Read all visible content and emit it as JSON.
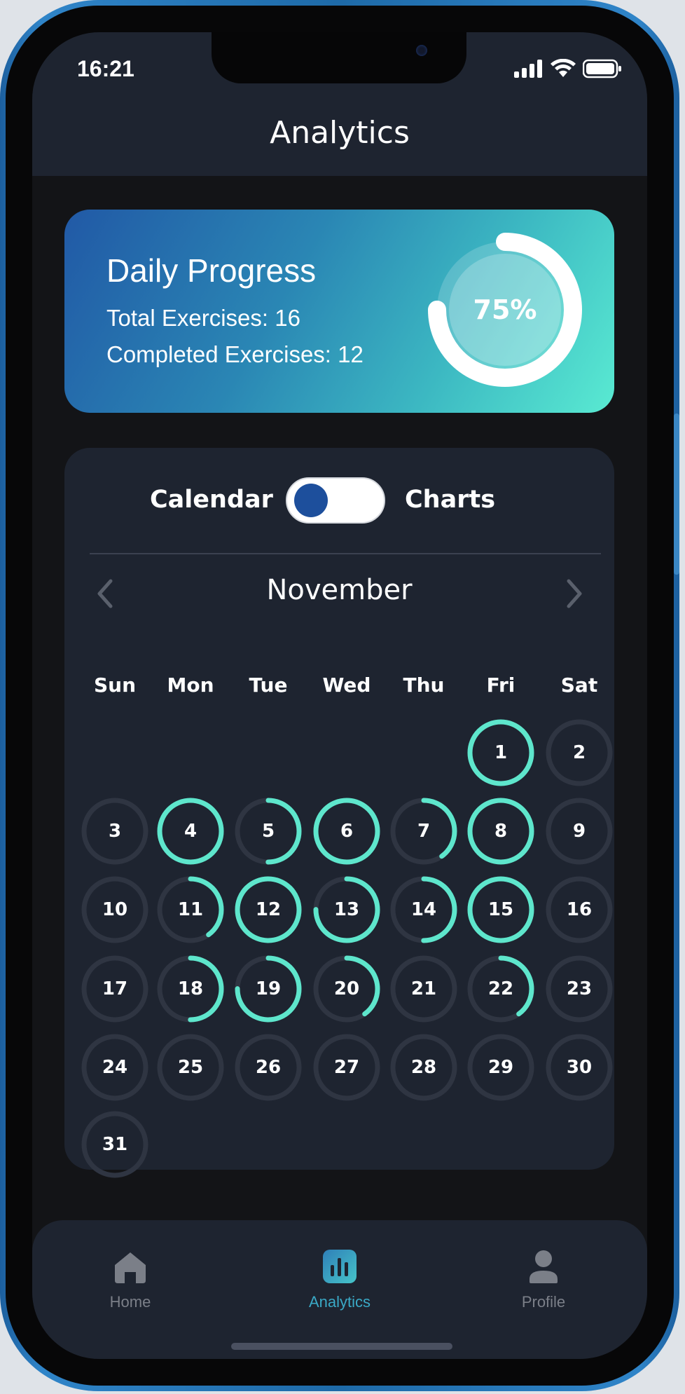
{
  "status_bar": {
    "time": "16:21"
  },
  "header": {
    "title": "Analytics"
  },
  "progress": {
    "title": "Daily Progress",
    "total_line": "Total Exercises: 16",
    "completed_line": "Completed Exercises: 12",
    "percent_label": "75%",
    "percent_value": 0.75,
    "ring_color": "#ffffff"
  },
  "view_toggle": {
    "left_label": "Calendar",
    "right_label": "Charts",
    "knob_color": "#1d4f9c"
  },
  "calendar": {
    "month": "November",
    "weekdays": [
      "Sun",
      "Mon",
      "Tue",
      "Wed",
      "Thu",
      "Fri",
      "Sat"
    ],
    "first_weekday_index": 5,
    "accent_color": "#5ee6cc",
    "track_color": "#2f3542",
    "days": [
      {
        "label": "1",
        "progress": 1.0
      },
      {
        "label": "2",
        "progress": 0
      },
      {
        "label": "3",
        "progress": 0
      },
      {
        "label": "4",
        "progress": 1.0
      },
      {
        "label": "5",
        "progress": 0.5
      },
      {
        "label": "6",
        "progress": 1.0
      },
      {
        "label": "7",
        "progress": 0.4
      },
      {
        "label": "8",
        "progress": 1.0
      },
      {
        "label": "9",
        "progress": 0
      },
      {
        "label": "10",
        "progress": 0
      },
      {
        "label": "11",
        "progress": 0.4
      },
      {
        "label": "12",
        "progress": 1.0
      },
      {
        "label": "13",
        "progress": 0.75
      },
      {
        "label": "14",
        "progress": 0.5
      },
      {
        "label": "15",
        "progress": 1.0
      },
      {
        "label": "16",
        "progress": 0
      },
      {
        "label": "17",
        "progress": 0
      },
      {
        "label": "18",
        "progress": 0.5
      },
      {
        "label": "19",
        "progress": 0.75
      },
      {
        "label": "20",
        "progress": 0.4
      },
      {
        "label": "21",
        "progress": 0
      },
      {
        "label": "22",
        "progress": 0.4
      },
      {
        "label": "23",
        "progress": 0
      },
      {
        "label": "24",
        "progress": 0
      },
      {
        "label": "25",
        "progress": 0
      },
      {
        "label": "26",
        "progress": 0
      },
      {
        "label": "27",
        "progress": 0
      },
      {
        "label": "28",
        "progress": 0
      },
      {
        "label": "29",
        "progress": 0
      },
      {
        "label": "30",
        "progress": 0
      },
      {
        "label": "31",
        "progress": 0
      }
    ]
  },
  "tabbar": {
    "items": [
      {
        "label": "Home",
        "icon": "home-icon",
        "active": false
      },
      {
        "label": "Analytics",
        "icon": "analytics-icon",
        "active": true
      },
      {
        "label": "Profile",
        "icon": "profile-icon",
        "active": false
      }
    ],
    "active_color": "#3aa9c6",
    "inactive_color": "#7b7f88"
  }
}
